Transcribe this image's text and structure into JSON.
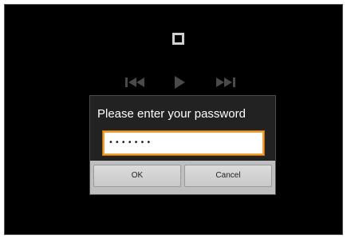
{
  "dialog": {
    "title": "Please enter your password",
    "password_value": "•••••••",
    "ok_label": "OK",
    "cancel_label": "Cancel"
  },
  "icons": {
    "stop": "stop-icon",
    "rewind": "rewind-icon",
    "play": "play-icon",
    "fast_forward": "fast-forward-icon"
  },
  "colors": {
    "background": "#000000",
    "dialog_background": "#222222",
    "input_focus_border": "#f0a030",
    "button_bar": "#bfbfbf"
  }
}
